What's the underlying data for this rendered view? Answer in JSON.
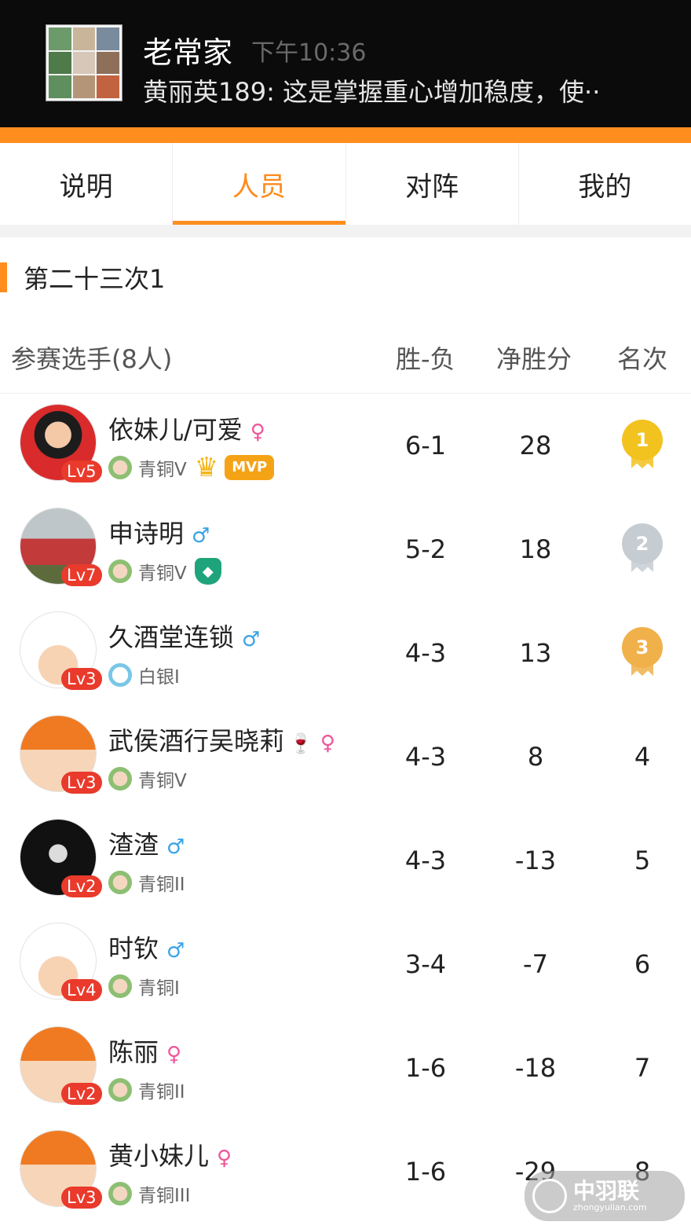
{
  "notification": {
    "title": "老常家",
    "time": "下午10:36",
    "message": "黄丽英189: 这是掌握重心增加稳度，使··"
  },
  "tabs": [
    {
      "label": "说明",
      "active": false
    },
    {
      "label": "人员",
      "active": true
    },
    {
      "label": "对阵",
      "active": false
    },
    {
      "label": "我的",
      "active": false
    }
  ],
  "section": {
    "title": "第二十三次1"
  },
  "columns": {
    "player": "参赛选手(8人)",
    "win_loss": "胜-负",
    "net_points": "净胜分",
    "rank": "名次"
  },
  "players": [
    {
      "name": "依妹儿/可爱",
      "gender": "♀",
      "level": "Lv5",
      "tier": "青铜V",
      "badges": "MVP",
      "win_loss": "6-1",
      "net": "28",
      "rank": "1"
    },
    {
      "name": "申诗明",
      "gender": "♂",
      "level": "Lv7",
      "tier": "青铜V",
      "win_loss": "5-2",
      "net": "18",
      "rank": "2"
    },
    {
      "name": "久酒堂连锁",
      "gender": "♂",
      "level": "Lv3",
      "tier": "白银I",
      "win_loss": "4-3",
      "net": "13",
      "rank": "3"
    },
    {
      "name": "武侯酒行吴晓莉",
      "gender": "♀",
      "level": "Lv3",
      "tier": "青铜V",
      "win_loss": "4-3",
      "net": "8",
      "rank": "4"
    },
    {
      "name": "渣渣",
      "gender": "♂",
      "level": "Lv2",
      "tier": "青铜II",
      "win_loss": "4-3",
      "net": "-13",
      "rank": "5"
    },
    {
      "name": "时钦",
      "gender": "♂",
      "level": "Lv4",
      "tier": "青铜I",
      "win_loss": "3-4",
      "net": "-7",
      "rank": "6"
    },
    {
      "name": "陈丽",
      "gender": "♀",
      "level": "Lv2",
      "tier": "青铜II",
      "win_loss": "1-6",
      "net": "-18",
      "rank": "7"
    },
    {
      "name": "黄小妹儿",
      "gender": "♀",
      "level": "Lv3",
      "tier": "青铜III",
      "win_loss": "1-6",
      "net": "-29",
      "rank": "8"
    }
  ],
  "watermark": {
    "name": "中羽联",
    "url": "zhongyulian.com"
  },
  "colors": {
    "accent": "#ff8e1f",
    "level_badge": "#e93a2c",
    "female": "#f0559a",
    "male": "#38a3e6"
  }
}
